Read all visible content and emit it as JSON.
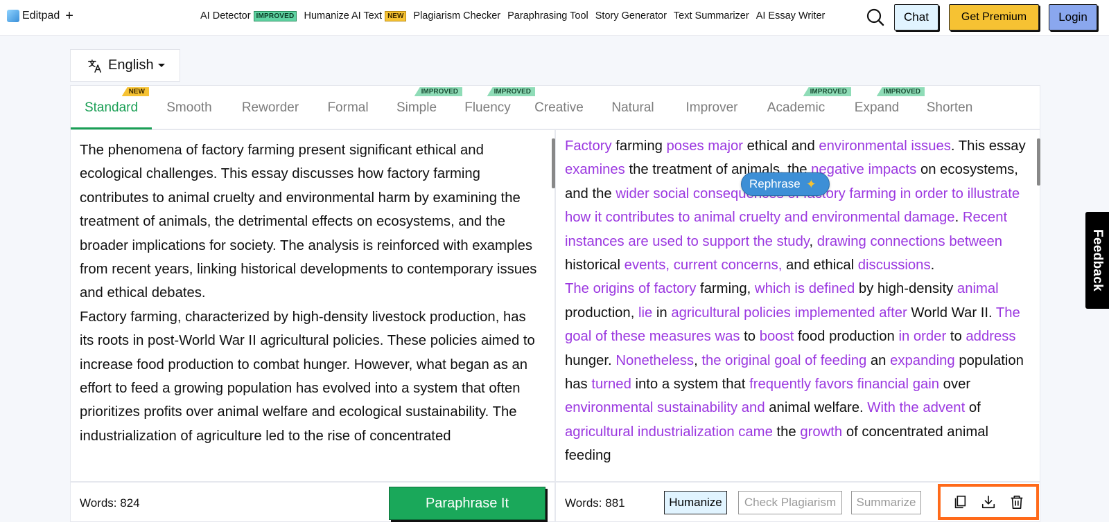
{
  "brand": {
    "name": "Editpad",
    "plus": "+"
  },
  "nav": {
    "items": [
      {
        "label": "AI Detector",
        "badge": "IMPROVED",
        "badge_type": "improved"
      },
      {
        "label": "Humanize AI Text",
        "badge": "NEW",
        "badge_type": "new"
      },
      {
        "label": "Plagiarism Checker"
      },
      {
        "label": "Paraphrasing Tool"
      },
      {
        "label": "Story Generator"
      },
      {
        "label": "Text Summarizer"
      },
      {
        "label": "AI Essay Writer"
      }
    ],
    "chat": "Chat",
    "premium": "Get Premium",
    "login": "Login"
  },
  "language": {
    "label": "English"
  },
  "tabs": [
    {
      "label": "Standard",
      "badge": "NEW",
      "badge_type": "new",
      "active": true
    },
    {
      "label": "Smooth"
    },
    {
      "label": "Reworder"
    },
    {
      "label": "Formal"
    },
    {
      "label": "Simple",
      "badge": "IMPROVED",
      "badge_type": "improved"
    },
    {
      "label": "Fluency",
      "badge": "IMPROVED",
      "badge_type": "improved"
    },
    {
      "label": "Creative"
    },
    {
      "label": "Natural"
    },
    {
      "label": "Improver"
    },
    {
      "label": "Academic",
      "badge": "IMPROVED",
      "badge_type": "improved"
    },
    {
      "label": "Expand",
      "badge": "IMPROVED",
      "badge_type": "improved"
    },
    {
      "label": "Shorten"
    }
  ],
  "input": {
    "paragraphs": [
      "The phenomena of factory farming present significant ethical and ecological challenges. This essay discusses how factory farming contributes to animal cruelty and environmental harm by examining the treatment of animals, the detrimental effects on ecosystems, and the broader implications for society. The analysis is reinforced with examples from recent years, linking historical developments to contemporary issues and ethical debates.",
      "Factory farming, characterized by high-density livestock production, has its roots in post-World War II agricultural policies. These policies aimed to increase food production to combat hunger. However, what began as an effort to feed a growing population has evolved into a system that often prioritizes profits over animal welfare and ecological sustainability. The industrialization of agriculture led to the rise of concentrated"
    ],
    "word_count": "Words: 824",
    "action": "Paraphrase It"
  },
  "output": {
    "paragraphs": [
      [
        {
          "t": "Factory",
          "c": true
        },
        {
          "t": " farming "
        },
        {
          "t": "poses major",
          "c": true
        },
        {
          "t": " ethical and "
        },
        {
          "t": "environmental issues",
          "c": true
        },
        {
          "t": ". This essay "
        },
        {
          "t": "examines",
          "c": true
        },
        {
          "t": " the treatment of animals, the "
        },
        {
          "t": "negative impacts",
          "c": true
        },
        {
          "t": " on ecosystems, and the "
        },
        {
          "t": "wider social consequences of factory farming in order to illustrate how it contributes to animal cruelty and environmental damage",
          "c": true
        },
        {
          "t": ". "
        },
        {
          "t": "Recent instances are used to support the study",
          "c": true
        },
        {
          "t": ", "
        },
        {
          "t": "drawing connections between",
          "c": true
        },
        {
          "t": " historical "
        },
        {
          "t": "events, current concerns,",
          "c": true
        },
        {
          "t": " and ethical "
        },
        {
          "t": "discussions",
          "c": true
        },
        {
          "t": "."
        }
      ],
      [
        {
          "t": "The origins of factory",
          "c": true
        },
        {
          "t": " farming, "
        },
        {
          "t": "which is defined",
          "c": true
        },
        {
          "t": " by high-density "
        },
        {
          "t": "animal",
          "c": true
        },
        {
          "t": " production, "
        },
        {
          "t": "lie",
          "c": true
        },
        {
          "t": " in "
        },
        {
          "t": "agricultural policies implemented after",
          "c": true
        },
        {
          "t": " World War II. "
        },
        {
          "t": "The goal of these measures was",
          "c": true
        },
        {
          "t": " to "
        },
        {
          "t": "boost",
          "c": true
        },
        {
          "t": " food production "
        },
        {
          "t": "in order",
          "c": true
        },
        {
          "t": " to "
        },
        {
          "t": "address",
          "c": true
        },
        {
          "t": " hunger. "
        },
        {
          "t": "Nonetheless",
          "c": true
        },
        {
          "t": ", "
        },
        {
          "t": "the original goal of feeding",
          "c": true
        },
        {
          "t": " an "
        },
        {
          "t": "expanding",
          "c": true
        },
        {
          "t": " population has "
        },
        {
          "t": "turned",
          "c": true
        },
        {
          "t": " into a system that "
        },
        {
          "t": "frequently favors financial gain",
          "c": true
        },
        {
          "t": " over "
        },
        {
          "t": "environmental sustainability and",
          "c": true
        },
        {
          "t": " animal welfare. "
        },
        {
          "t": "With the advent",
          "c": true
        },
        {
          "t": " of "
        },
        {
          "t": "agricultural industrialization came",
          "c": true
        },
        {
          "t": " the "
        },
        {
          "t": "growth",
          "c": true
        },
        {
          "t": " of concentrated animal feeding"
        }
      ]
    ],
    "word_count": "Words: 881",
    "humanize": "Humanize",
    "check_plagiarism": "Check Plagiarism",
    "summarize": "Summarize",
    "rephrase_chip": "Rephrase"
  },
  "feedback": "Feedback",
  "colors": {
    "accent_green": "#1aa85a",
    "changed_text": "#9b38e0",
    "highlight_border": "#ff6a1a"
  }
}
